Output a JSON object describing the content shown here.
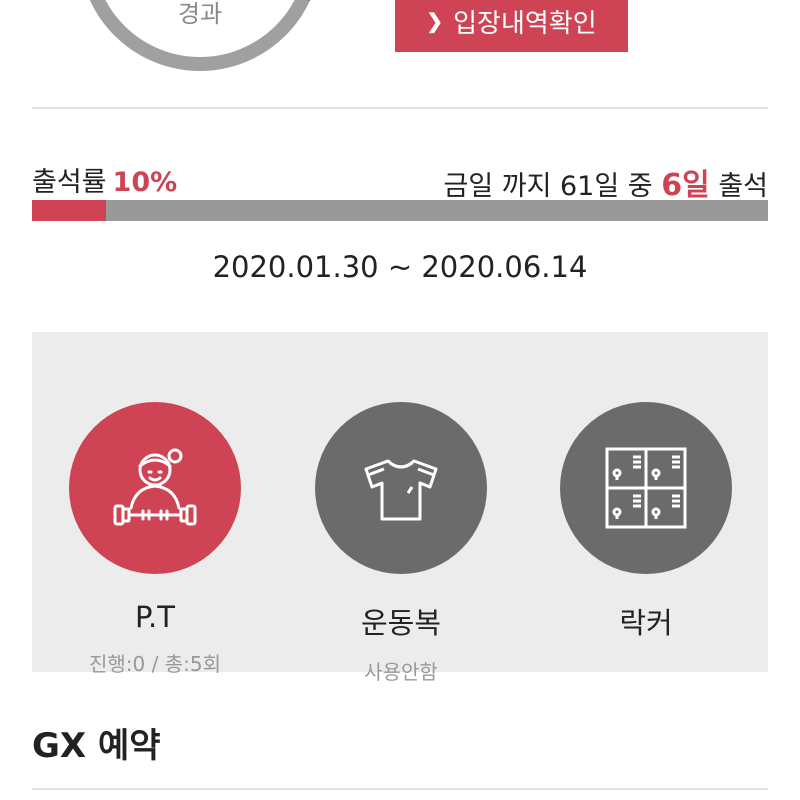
{
  "donut": {
    "label": "경과",
    "progress_fraction": 0.17,
    "track_color": "#a0a0a0",
    "progress_color": "#cf4455"
  },
  "entry_button": {
    "label": "입장내역확인",
    "icon": "chevron-right-icon"
  },
  "attendance": {
    "rate_label": "출석률",
    "rate_value": "10%",
    "summary_prefix": "금일 까지 61일 중",
    "attended_days": "6일",
    "summary_suffix": "출석",
    "progress_fraction": 0.1
  },
  "date_range": "2020.01.30 ~ 2020.06.14",
  "services": [
    {
      "name": "P.T",
      "status": "진행:0 / 총:5회",
      "icon": "trainer-icon",
      "active": true
    },
    {
      "name": "운동복",
      "status": "사용안함",
      "icon": "tshirt-icon",
      "active": false
    },
    {
      "name": "락커",
      "status": "",
      "icon": "locker-icon",
      "active": false
    }
  ],
  "gx_section": {
    "title": "GX 예약"
  },
  "colors": {
    "accent": "#cf4455",
    "inactive_circle": "#6b6b6b",
    "panel_bg": "#ececec"
  }
}
